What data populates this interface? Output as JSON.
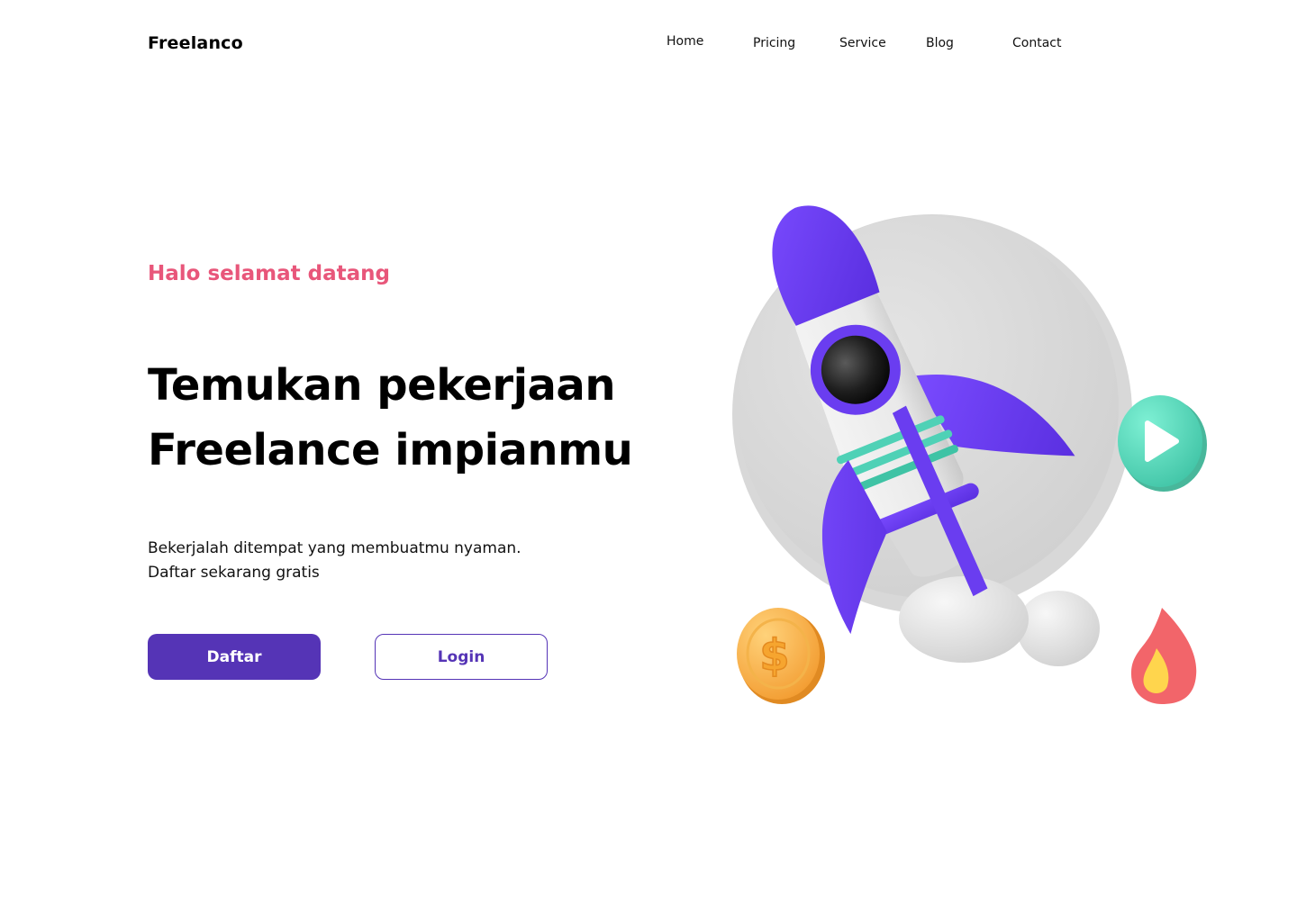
{
  "brand": {
    "name": "Freelanco"
  },
  "nav": {
    "items": [
      {
        "label": "Home"
      },
      {
        "label": "Pricing"
      },
      {
        "label": "Service"
      },
      {
        "label": "Blog"
      },
      {
        "label": "Contact"
      }
    ]
  },
  "hero": {
    "greeting": "Halo selamat datang",
    "headline_line1": "Temukan pekerjaan",
    "headline_line2": "Freelance impianmu",
    "description_line1": "Bekerjalah ditempat yang membuatmu nyaman.",
    "description_line2": "Daftar sekarang gratis",
    "primary_button": "Daftar",
    "secondary_button": "Login"
  },
  "illustration": {
    "icons": [
      "rocket-icon",
      "play-icon",
      "coin-icon",
      "fire-icon",
      "circle-backdrop"
    ],
    "coin_symbol": "$"
  },
  "colors": {
    "brand_purple": "#5534b6",
    "accent_pink": "#e8567a",
    "rocket_purple": "#6a3df0",
    "teal": "#4fd1b6",
    "coin_orange": "#f7a83b",
    "fire_red": "#f2656a"
  }
}
